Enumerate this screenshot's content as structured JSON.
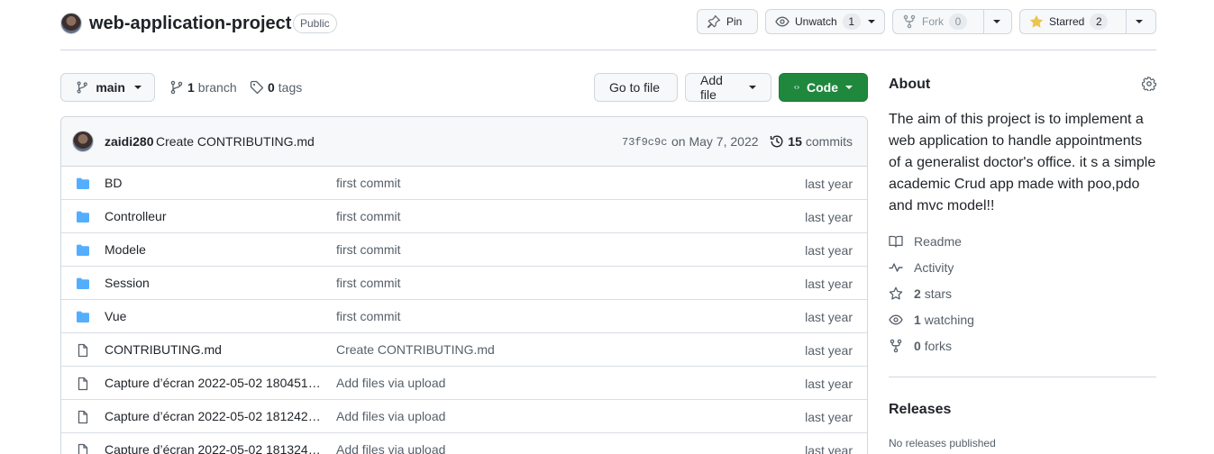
{
  "repo": {
    "name": "web-application-project",
    "visibility": "Public"
  },
  "header_actions": {
    "pin_label": "Pin",
    "unwatch_label": "Unwatch",
    "unwatch_count": "1",
    "fork_label": "Fork",
    "fork_count": "0",
    "starred_label": "Starred",
    "starred_count": "2"
  },
  "toolbar": {
    "branch_name": "main",
    "branch_count": "1",
    "branch_word": "branch",
    "tag_count": "0",
    "tag_word": "tags",
    "go_to_file_label": "Go to file",
    "add_file_label": "Add file",
    "code_label": "Code"
  },
  "latest_commit": {
    "author": "zaidi280",
    "message": "Create CONTRIBUTING.md",
    "sha": "73f9c9c",
    "date": "on May 7, 2022",
    "commit_count": "15",
    "commit_word": "commits"
  },
  "files": [
    {
      "type": "folder",
      "name": "BD",
      "commit": "first commit",
      "age": "last year"
    },
    {
      "type": "folder",
      "name": "Controlleur",
      "commit": "first commit",
      "age": "last year"
    },
    {
      "type": "folder",
      "name": "Modele",
      "commit": "first commit",
      "age": "last year"
    },
    {
      "type": "folder",
      "name": "Session",
      "commit": "first commit",
      "age": "last year"
    },
    {
      "type": "folder",
      "name": "Vue",
      "commit": "first commit",
      "age": "last year"
    },
    {
      "type": "file",
      "name": "CONTRIBUTING.md",
      "commit": "Create CONTRIBUTING.md",
      "age": "last year"
    },
    {
      "type": "file",
      "name": "Capture d’écran 2022-05-02 180451....",
      "commit": "Add files via upload",
      "age": "last year"
    },
    {
      "type": "file",
      "name": "Capture d’écran 2022-05-02 181242....",
      "commit": "Add files via upload",
      "age": "last year"
    },
    {
      "type": "file",
      "name": "Capture d’écran 2022-05-02 181324....",
      "commit": "Add files via upload",
      "age": "last year"
    }
  ],
  "about": {
    "title": "About",
    "description": "The aim of this project is to implement a web application to handle appointments of a generalist doctor's office. it s a simple academic Crud app made with poo,pdo and mvc model!!",
    "readme_label": "Readme",
    "activity_label": "Activity",
    "stars_count": "2",
    "stars_word": "stars",
    "watching_count": "1",
    "watching_word": "watching",
    "forks_count": "0",
    "forks_word": "forks"
  },
  "releases": {
    "title": "Releases",
    "note": "No releases published"
  },
  "colors": {
    "code_button": "#1f883d",
    "folder_icon": "#54aeff",
    "star_icon": "#eac54f"
  }
}
